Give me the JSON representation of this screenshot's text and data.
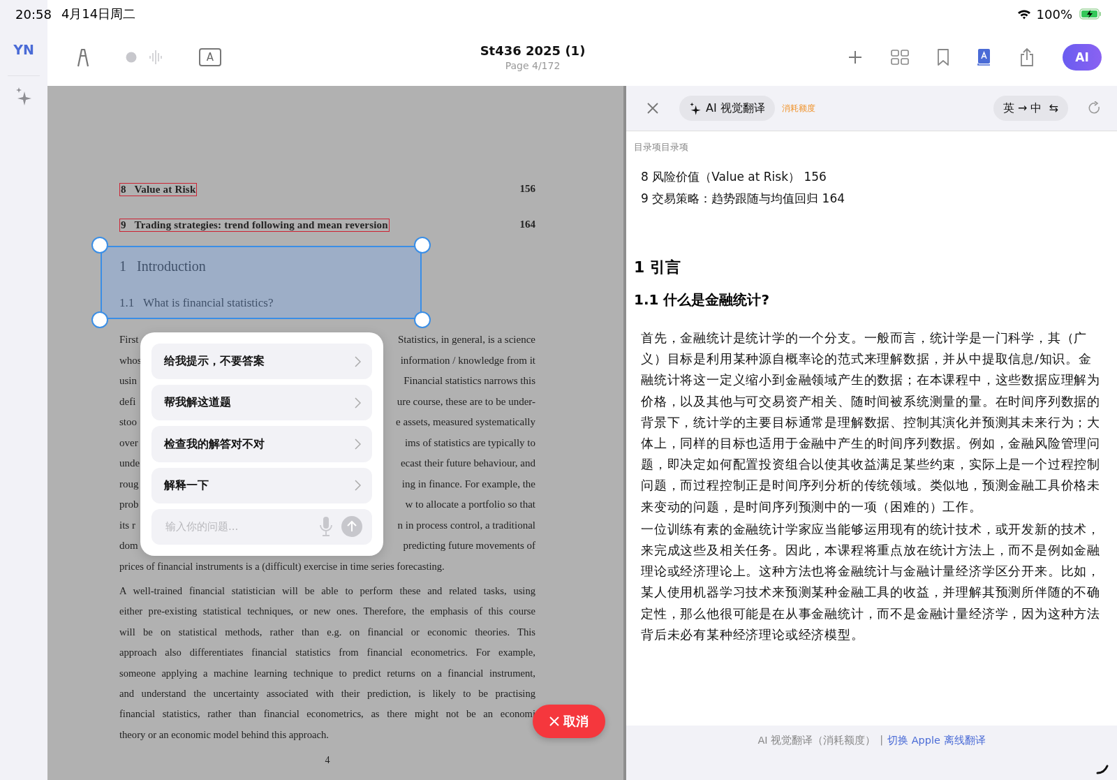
{
  "status_bar": {
    "time": "20:58",
    "date": "4月14日周二",
    "battery": "100%"
  },
  "sidebar": {
    "avatar": "YN"
  },
  "toolbar": {
    "text_tool_label": "A",
    "title": "St436 2025 (1)",
    "subtitle": "Page 4/172",
    "ai_button": "AI"
  },
  "pdf": {
    "toc": [
      {
        "number": "8",
        "title": "Value at Risk",
        "page": "156"
      },
      {
        "number": "9",
        "title": "Trading strategies: trend following and mean reversion",
        "page": "164"
      }
    ],
    "section": {
      "number": "1",
      "title": "Introduction"
    },
    "subsection": {
      "number": "1.1",
      "title": "What is financial statistics?"
    },
    "partial_lines": [
      {
        "left": "First",
        "right": "Statistics, in general, is a science"
      },
      {
        "left": "whos",
        "right": "information / knowledge from it"
      },
      {
        "left": "usin",
        "right": "Financial statistics narrows this"
      },
      {
        "left": "defi",
        "right": "ure course, these are to be under-"
      },
      {
        "left": "stoo",
        "right": "e assets, measured systematically"
      },
      {
        "left": "over",
        "right": "ims of statistics are typically to"
      },
      {
        "left": "unde",
        "right": "ecast their future behaviour, and"
      },
      {
        "left": "roug",
        "right": "ing in finance.  For example, the"
      },
      {
        "left": "prob",
        "right": "w to allocate a portfolio so that"
      },
      {
        "left": "its r",
        "right": "n in process control, a traditional"
      },
      {
        "left": "dom",
        "right": "predicting future movements of"
      }
    ],
    "last_line": "prices of financial instruments is a (difficult) exercise in time series forecasting.",
    "paragraph_lines": [
      "A well-trained financial statistician will be able to perform these and related tasks, using",
      "either pre-existing statistical techniques, or new ones. Therefore, the emphasis of this course",
      "will be on statistical methods, rather than e.g.  on financial or economic theories.  This",
      "approach also differentiates financial statistics from financial econometrics.  For example,",
      "someone applying a machine learning technique to predict returns on a financial instrument,",
      "and understand the uncertainty associated with their prediction, is likely to be practising",
      "financial statistics, rather than financial econometrics, as there might not be an economi",
      "theory or an economic model behind this approach."
    ],
    "page_number": "4"
  },
  "ai_menu": {
    "options": [
      "给我提示，不要答案",
      "帮我解这道题",
      "检查我的解答对不对",
      "解释一下"
    ],
    "input": {
      "placeholder": "输入你的问题..."
    }
  },
  "cancel_button": "取消",
  "translation": {
    "mode": "AI 视觉翻译",
    "quota": "消耗额度",
    "languages": "英 → 中",
    "swap_symbol": "⇆",
    "section_label": "目录项目录项",
    "toc": [
      "8 风险价值（Value at Risk） 156",
      "9 交易策略：趋势跟随与均值回归 164"
    ],
    "h1": "1 引言",
    "h2": "1.1 什么是金融统计?",
    "paragraphs": [
      "首先，金融统计是统计学的一个分支。一般而言，统计学是一门科学，其（广义）目标是利用某种源自概率论的范式来理解数据，并从中提取信息/知识。金融统计将这一定义缩小到金融领域产生的数据；在本课程中，这些数据应理解为价格，以及其他与可交易资产相关、随时间被系统测量的量。在时间序列数据的背景下，统计学的主要目标通常是理解数据、控制其演化并预测其未来行为；大体上，同样的目标也适用于金融中产生的时间序列数据。例如，金融风险管理问题，即决定如何配置投资组合以使其收益满足某些约束，实际上是一个过程控制问题，而过程控制正是时间序列分析的传统领域。类似地，预测金融工具价格未来变动的问题，是时间序列预测中的一项（困难的）工作。",
      "一位训练有素的金融统计学家应当能够运用现有的统计技术，或开发新的技术，来完成这些及相关任务。因此，本课程将重点放在统计方法上，而不是例如金融理论或经济理论上。这种方法也将金融统计与金融计量经济学区分开来。比如，某人使用机器学习技术来预测某种金融工具的收益，并理解其预测所伴随的不确定性，那么他很可能是在从事金融统计，而不是金融计量经济学，因为这种方法背后未必有某种经济理论或经济模型。"
    ],
    "footer": {
      "note": "AI 视觉翻译（消耗额度）",
      "separator": "|",
      "link": "切换 Apple 离线翻译"
    }
  }
}
